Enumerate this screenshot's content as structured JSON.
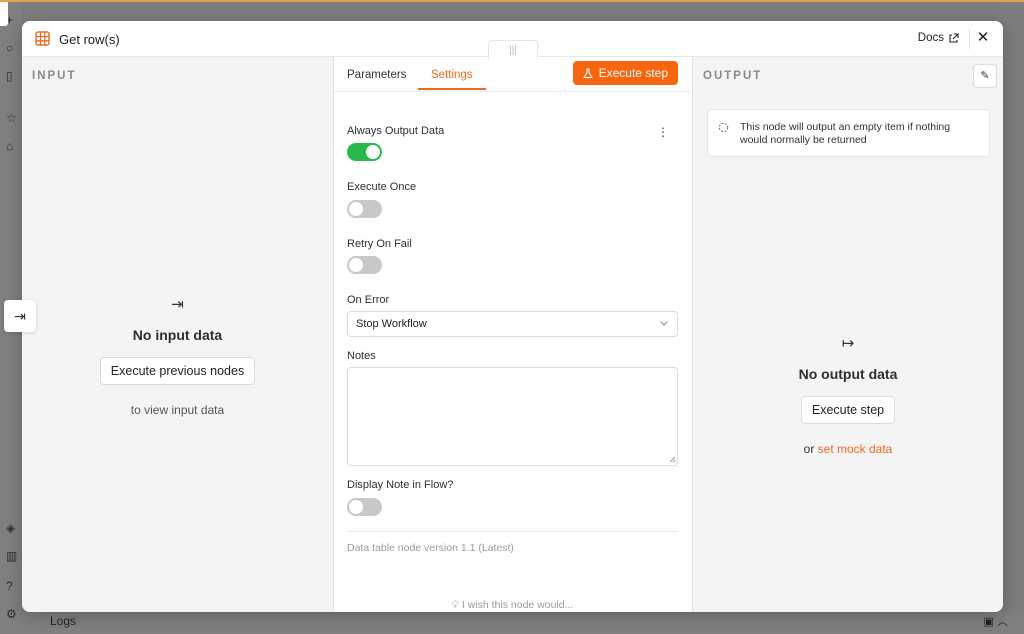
{
  "colors": {
    "accent": "#f7650f",
    "toggle_on": "#28b84c",
    "toggle_off": "#c8c8c8"
  },
  "background": {
    "logs_label": "Logs"
  },
  "header": {
    "node_icon": "table-icon",
    "title": "Get row(s)",
    "docs_label": "Docs",
    "close_icon": "close-icon"
  },
  "input_panel": {
    "label": "INPUT",
    "empty_icon": "arrow-into-bar-icon",
    "empty_title": "No input data",
    "button_label": "Execute previous nodes",
    "subtext": "to view input data"
  },
  "settings_panel": {
    "tabs": [
      {
        "label": "Parameters",
        "active": false
      },
      {
        "label": "Settings",
        "active": true
      }
    ],
    "execute_step_label": "Execute step",
    "fields": {
      "always_output_data": {
        "label": "Always Output Data",
        "value": true
      },
      "execute_once": {
        "label": "Execute Once",
        "value": false
      },
      "retry_on_fail": {
        "label": "Retry On Fail",
        "value": false
      },
      "on_error": {
        "label": "On Error",
        "value": "Stop Workflow"
      },
      "notes": {
        "label": "Notes",
        "value": ""
      },
      "display_note": {
        "label": "Display Note in Flow?",
        "value": false
      }
    },
    "version_text": "Data table node version 1.1 (Latest)",
    "wish_text": "I wish this node would..."
  },
  "output_panel": {
    "label": "OUTPUT",
    "info_text": "This node will output an empty item if nothing would normally be returned",
    "empty_icon": "arrow-out-of-bar-icon",
    "empty_title": "No output data",
    "button_label": "Execute step",
    "mock_prefix": "or",
    "mock_link": "set mock data"
  }
}
